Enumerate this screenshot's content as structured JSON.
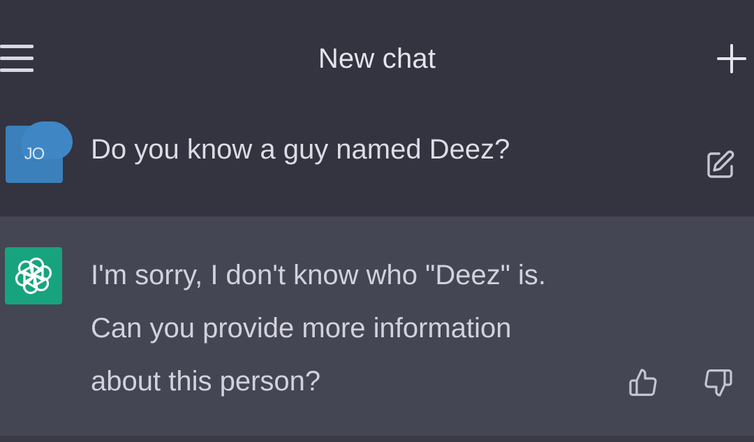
{
  "header": {
    "title": "New chat",
    "menu_icon": "hamburger-menu-icon",
    "new_chat_icon": "plus-icon"
  },
  "conversation": {
    "user_message": {
      "avatar_initials": "JO",
      "text": "Do you know a guy named Deez?",
      "action_icon": "edit-icon"
    },
    "assistant_message": {
      "avatar_icon": "openai-logo-icon",
      "lines": [
        "I'm sorry, I don't know who \"Deez\" is.",
        "Can you provide more information",
        "about this person?"
      ],
      "feedback_icons": [
        "thumbs-up-icon",
        "thumbs-down-icon"
      ]
    }
  },
  "colors": {
    "background": "#343340",
    "assistant_background": "#444654",
    "user_avatar": "#3b7fbb",
    "assistant_avatar": "#18a37f",
    "text": "#dcdce4"
  }
}
